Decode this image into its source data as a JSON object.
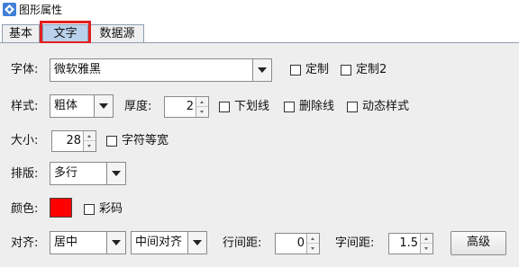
{
  "window": {
    "title": "图形属性"
  },
  "tabs": [
    {
      "label": "基本"
    },
    {
      "label": "文字"
    },
    {
      "label": "数据源"
    }
  ],
  "font": {
    "label": "字体:",
    "value": "微软雅黑",
    "custom_label": "定制",
    "custom2_label": "定制2"
  },
  "style": {
    "label": "样式:",
    "value": "粗体",
    "thickness_label": "厚度:",
    "thickness": "2",
    "underline_label": "下划线",
    "strikethrough_label": "删除线",
    "dynamic_style_label": "动态样式"
  },
  "size": {
    "label": "大小:",
    "value": "28",
    "monospace_label": "字符等宽"
  },
  "layout": {
    "label": "排版:",
    "value": "多行"
  },
  "color": {
    "label": "颜色:",
    "swatch": "#ff0000",
    "colorcode_label": "彩码"
  },
  "align": {
    "label": "对齐:",
    "horizontal": "居中",
    "vertical": "中间对齐",
    "line_spacing_label": "行间距:",
    "line_spacing": "0",
    "char_spacing_label": "字间距:",
    "char_spacing": "1.5",
    "advanced_button": "高级"
  },
  "colors": {
    "active_tab": "#b9d1ea",
    "highlight_box": "#e02020",
    "panel_bg": "#eeeeee"
  }
}
